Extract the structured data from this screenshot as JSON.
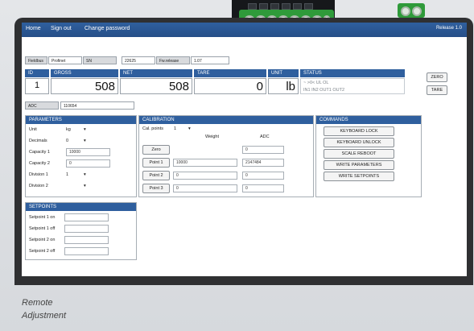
{
  "nav": {
    "home": "Home",
    "sign_out": "Sign out",
    "change_password": "Change password",
    "release": "Release 1.0"
  },
  "device": {
    "leds": [
      "●",
      "▪",
      "▪",
      "▪",
      "▪",
      "▪",
      "▪",
      "▪"
    ]
  },
  "info_row": {
    "fieldbus_label": "Fieldbus",
    "fieldbus_value": "Profinet",
    "sn_label": "SN",
    "sn_value": "22625",
    "fwrelease_label": "Fw.release",
    "fwrelease_value": "1.07"
  },
  "weights": {
    "id": {
      "label": "ID",
      "value": "1"
    },
    "gross": {
      "label": "GROSS",
      "value": "508"
    },
    "net": {
      "label": "NET",
      "value": "508"
    },
    "tare": {
      "label": "TARE",
      "value": "0"
    },
    "unit": {
      "label": "UNIT",
      "value": "lb"
    },
    "status": {
      "label": "STATUS",
      "line1": "~   >0<   UL    OL",
      "line2": "IN1  IN2  OUT1  OUT2"
    }
  },
  "buttons": {
    "zero": "ZERO",
    "tare": "TARE"
  },
  "adc": {
    "label": "ADC",
    "value": "110654"
  },
  "parameters": {
    "title": "PARAMETERS",
    "rows": [
      {
        "label": "Unit",
        "value": "kg",
        "type": "select"
      },
      {
        "label": "Decimals",
        "value": "0",
        "type": "select"
      },
      {
        "label": "Capacity 1",
        "value": "10000",
        "type": "input"
      },
      {
        "label": "Capacity 2",
        "value": "0",
        "type": "input"
      },
      {
        "label": "Division 1",
        "value": "1",
        "type": "select"
      },
      {
        "label": "Division 2",
        "value": "",
        "type": "select"
      }
    ]
  },
  "calibration": {
    "title": "CALIBRATION",
    "cal_points_label": "Cal. points",
    "cal_points_value": "1",
    "weight_header": "Weight",
    "adc_header": "ADC",
    "zero_button": "Zero",
    "zero_adc": "0",
    "points": [
      {
        "button": "Point 1",
        "weight": "10000",
        "adc": "2147484"
      },
      {
        "button": "Point 2",
        "weight": "0",
        "adc": "0"
      },
      {
        "button": "Point 3",
        "weight": "0",
        "adc": "0"
      }
    ]
  },
  "commands": {
    "title": "COMMANDS",
    "items": [
      "KEYBOARD LOCK",
      "KEYBOARD UNLOCK",
      "SCALE REBOOT",
      "WRITE PARAMETERS",
      "WRITE SETPOINTS"
    ]
  },
  "setpoints": {
    "title": "SETPOINTS",
    "rows": [
      "Setpoint 1 on",
      "Setpoint 1 off",
      "Setpoint 2 on",
      "Setpoint 2 off"
    ]
  },
  "caption": {
    "line1": "Remote",
    "line2": "Adjustment"
  }
}
